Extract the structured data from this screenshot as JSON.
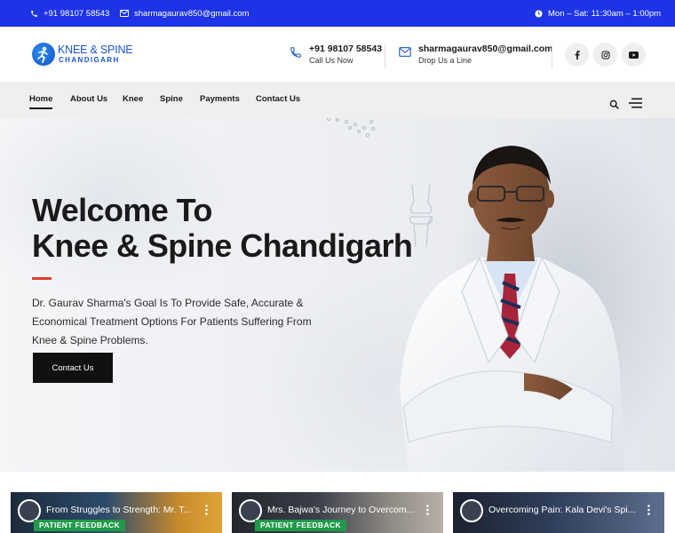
{
  "topbar": {
    "phone": "+91 98107 58543",
    "email": "sharmagaurav850@gmail.com",
    "hours": "Mon – Sat: 11:30am – 1:00pm"
  },
  "logo": {
    "line1": "KNEE & SPINE",
    "line2": "CHANDIGARH"
  },
  "header": {
    "phone": {
      "value": "+91 98107 58543",
      "caption": "Call Us Now"
    },
    "email": {
      "value": "sharmagaurav850@gmail.com",
      "caption": "Drop Us a Line"
    },
    "social": [
      "facebook-icon",
      "instagram-icon",
      "youtube-icon"
    ]
  },
  "nav": {
    "items": [
      "Home",
      "About Us",
      "Knee",
      "Spine",
      "Payments",
      "Contact Us"
    ],
    "active": "Home"
  },
  "hero": {
    "title_line1": "Welcome To",
    "title_line2": "Knee & Spine Chandigarh",
    "description": "Dr. Gaurav Sharma's Goal Is To Provide Safe, Accurate & Economical Treatment Options For Patients Suffering From Knee & Spine Problems.",
    "button": "Contact Us"
  },
  "videos": [
    {
      "title": "From Struggles to Strength: Mr. T...",
      "badge": "PATIENT FEEDBACK"
    },
    {
      "title": "Mrs. Bajwa's Journey to Overcom...",
      "badge": "PATIENT FEEDBACK"
    },
    {
      "title": "Overcoming Pain: Kala Devi's Spi...",
      "badge": ""
    }
  ],
  "colors": {
    "topbar": "#1c34e6",
    "brand_blue": "#1a56c9",
    "accent_red": "#e03b2c",
    "button_dark": "#111111",
    "badge_green": "#1f9a4a"
  }
}
